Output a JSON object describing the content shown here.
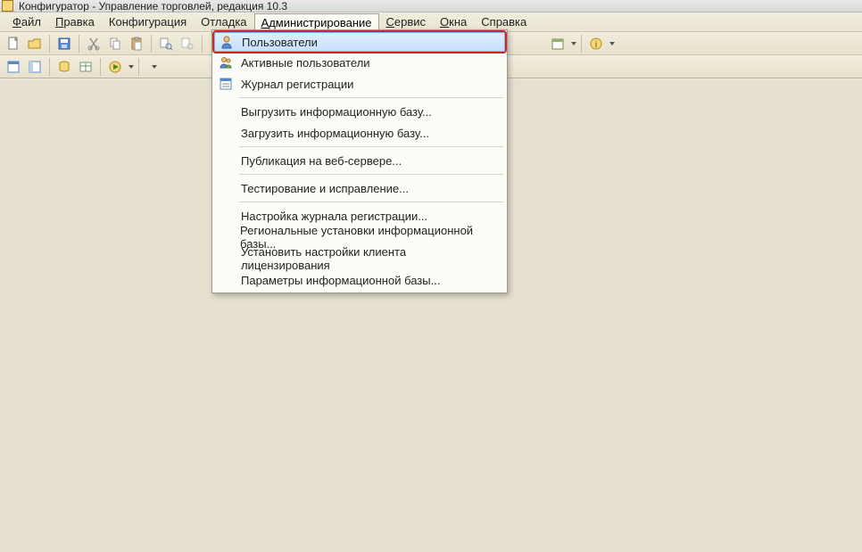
{
  "title": "Конфигуратор - Управление торговлей, редакция 10.3",
  "menubar": {
    "items": [
      {
        "label": "Файл",
        "ul": "Ф"
      },
      {
        "label": "Правка",
        "ul": "П"
      },
      {
        "label": "Конфигурация",
        "ul": ""
      },
      {
        "label": "Отладка",
        "ul": ""
      },
      {
        "label": "Администрирование",
        "ul": "А"
      },
      {
        "label": "Сервис",
        "ul": "С"
      },
      {
        "label": "Окна",
        "ul": "О"
      },
      {
        "label": "Справка",
        "ul": ""
      }
    ],
    "active_index": 4
  },
  "dropdown": {
    "items": [
      {
        "label": "Пользователи",
        "icon": "user",
        "highlight": true,
        "red": true
      },
      {
        "label": "Активные пользователи",
        "icon": "users"
      },
      {
        "label": "Журнал регистрации",
        "icon": "journal"
      },
      {
        "divider": true
      },
      {
        "label": "Выгрузить информационную базу..."
      },
      {
        "label": "Загрузить информационную базу..."
      },
      {
        "divider": true
      },
      {
        "label": "Публикация на веб-сервере..."
      },
      {
        "divider": true
      },
      {
        "label": "Тестирование и исправление..."
      },
      {
        "divider": true
      },
      {
        "label": "Настройка журнала регистрации..."
      },
      {
        "label": "Региональные установки информационной базы..."
      },
      {
        "label": "Установить настройки клиента лицензирования"
      },
      {
        "label": "Параметры информационной базы..."
      }
    ]
  },
  "post_menu_toolbar_visible_count": 2
}
